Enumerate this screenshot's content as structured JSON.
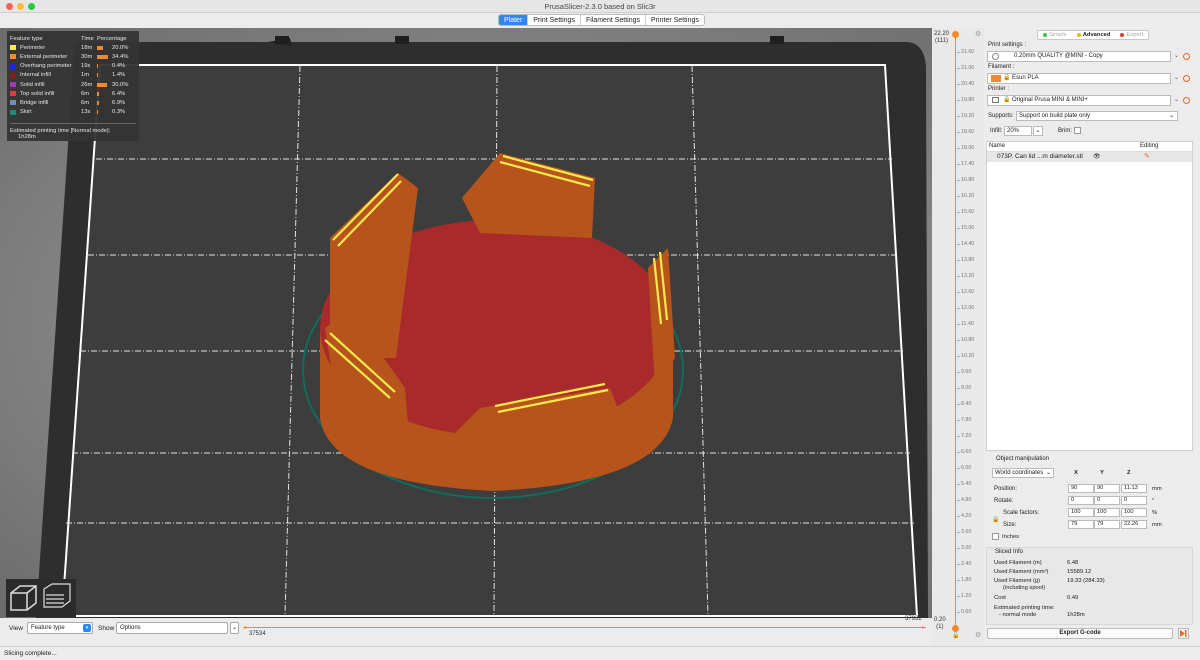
{
  "window": {
    "title": "PrusaSlicer-2.3.0 based on Slic3r"
  },
  "tabs": [
    {
      "label": "Plater",
      "active": true
    },
    {
      "label": "Print Settings",
      "active": false
    },
    {
      "label": "Filament Settings",
      "active": false
    },
    {
      "label": "Printer Settings",
      "active": false
    }
  ],
  "legend": {
    "headers": {
      "type": "Feature type",
      "time": "Time",
      "percentage": "Percentage"
    },
    "rows": [
      {
        "color": "#ffe94a",
        "name": "Perimeter",
        "time": "18m",
        "percentage": "20.0%",
        "fraction": 0.2
      },
      {
        "color": "#f28a2d",
        "name": "External perimeter",
        "time": "30m",
        "percentage": "34.4%",
        "fraction": 0.344
      },
      {
        "color": "#2326d8",
        "name": "Overhang perimeter",
        "time": "19s",
        "percentage": "0.4%",
        "fraction": 0.004
      },
      {
        "color": "#8b1a1a",
        "name": "Internal infill",
        "time": "1m",
        "percentage": "1.4%",
        "fraction": 0.014
      },
      {
        "color": "#a43ab8",
        "name": "Solid infill",
        "time": "26m",
        "percentage": "30.0%",
        "fraction": 0.3
      },
      {
        "color": "#e03c3c",
        "name": "Top solid infill",
        "time": "6m",
        "percentage": "6.4%",
        "fraction": 0.064
      },
      {
        "color": "#6f8fb8",
        "name": "Bridge infill",
        "time": "6m",
        "percentage": "6.9%",
        "fraction": 0.069
      },
      {
        "color": "#148f78",
        "name": "Skirt",
        "time": "13s",
        "percentage": "0.3%",
        "fraction": 0.003
      }
    ],
    "estimated": "Estimated printing time [Normal mode]:",
    "estimated_value": "1h28m"
  },
  "bottom": {
    "view_label": "View",
    "view_value": "Feature type",
    "show_label": "Show",
    "show_value": "Options",
    "h_left": "37534",
    "h_right": "37932"
  },
  "vslider": {
    "top_value": "22.20",
    "top_layer": "(111)",
    "bottom_value": "0.20",
    "bottom_layer": "(1)",
    "ticks": [
      "21.60",
      "21.00",
      "20.40",
      "19.80",
      "19.20",
      "18.60",
      "18.00",
      "17.40",
      "16.80",
      "16.20",
      "15.60",
      "15.00",
      "14.40",
      "13.80",
      "13.20",
      "12.60",
      "12.00",
      "11.40",
      "10.80",
      "10.20",
      "9.60",
      "9.00",
      "8.40",
      "7.80",
      "7.20",
      "6.60",
      "6.00",
      "5.40",
      "4.80",
      "4.20",
      "3.60",
      "3.00",
      "2.40",
      "1.80",
      "1.20",
      "0.60"
    ]
  },
  "panel": {
    "modes": [
      {
        "label": "Simple",
        "color": "#2ecc40",
        "on": false
      },
      {
        "label": "Advanced",
        "color": "#f4b400",
        "on": true
      },
      {
        "label": "Expert",
        "color": "#e53935",
        "on": false
      }
    ],
    "print_settings_label": "Print settings :",
    "print_settings_value": "0.20mm QUALITY @MINI - Copy",
    "filament_label": "Filament :",
    "filament_value": "Esun PLA",
    "filament_color": "#f28a2d",
    "printer_label": "Printer :",
    "printer_value": "Original Prusa MINI & MINI+",
    "supports_label": "Supports:",
    "supports_value": "Support on build plate only",
    "infill_label": "Infill:",
    "infill_value": "20%",
    "brim_label": "Brim:",
    "list_name_header": "Name",
    "list_editing_header": "Editing",
    "object_name": "073P. Can lid ...m diameter.stl"
  },
  "object_manipulation": {
    "title": "Object manipulation",
    "coord_system": "World coordinates",
    "x_header": "X",
    "y_header": "Y",
    "z_header": "Z",
    "position_label": "Position:",
    "position": [
      "90",
      "90",
      "11.13"
    ],
    "position_unit": "mm",
    "rotate_label": "Rotate:",
    "rotate": [
      "0",
      "0",
      "0"
    ],
    "rotate_unit": "°",
    "scale_label": "Scale factors:",
    "scale": [
      "100",
      "100",
      "100"
    ],
    "scale_unit": "%",
    "size_label": "Size:",
    "size": [
      "79",
      "79",
      "22.26"
    ],
    "size_unit": "mm",
    "inches_label": "Inches"
  },
  "sliced_info": {
    "title": "Sliced Info",
    "used_m_label": "Used Filament (m)",
    "used_m": "6.48",
    "used_mm3_label": "Used Filament (mm³)",
    "used_mm3": "15589.12",
    "used_g_label": "Used Filament (g)",
    "used_g_sub": "(including spool)",
    "used_g": "19.33 (284.33)",
    "cost_label": "Cost",
    "cost": "0.49",
    "est_label": "Estimated printing time:",
    "est_sub": "- normal mode",
    "est": "1h28m",
    "export_label": "Export G-code"
  },
  "status": "Slicing complete..."
}
